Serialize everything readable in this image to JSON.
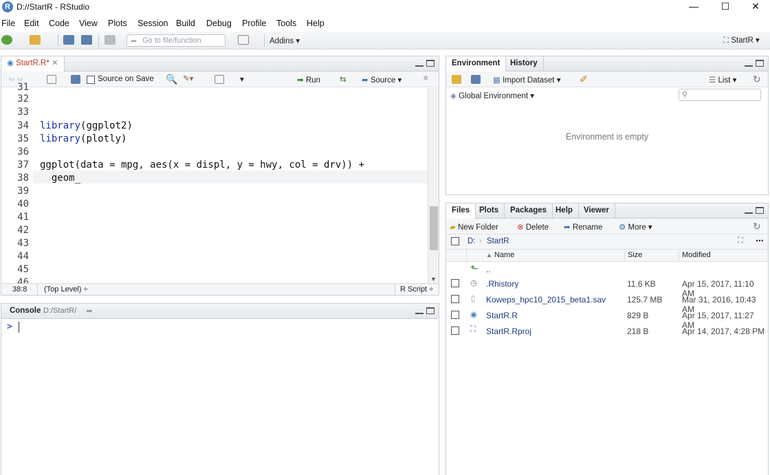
{
  "window": {
    "title": "D://StartR - RStudio",
    "logo_letter": "R",
    "minimize": "—",
    "maximize": "☐",
    "close": "✕"
  },
  "menu": [
    "File",
    "Edit",
    "Code",
    "View",
    "Plots",
    "Session",
    "Build",
    "Debug",
    "Profile",
    "Tools",
    "Help"
  ],
  "toolbar": {
    "goto_placeholder": "Go to file/function",
    "addins": "Addins",
    "project": "StartR"
  },
  "editor": {
    "tab_label": "StartR.R*",
    "source_on_save": "Source on Save",
    "run": "Run",
    "source": "Source",
    "line_numbers": [
      "31",
      "32",
      "33",
      "34",
      "35",
      "36",
      "37",
      "38",
      "39",
      "40",
      "41",
      "42",
      "43",
      "44",
      "45",
      "46"
    ],
    "code_lines": [
      {
        "line": "34",
        "fn": "library",
        "rest": "(ggplot2)"
      },
      {
        "line": "35",
        "fn": "library",
        "rest": "(plotly)"
      },
      {
        "line": "37",
        "fn": "",
        "rest": "ggplot(data = mpg, aes(x = displ, y = hwy, col = drv)) +"
      },
      {
        "line": "38",
        "fn": "",
        "rest": "  geom_"
      }
    ],
    "cursor_pos": "38:8",
    "scope": "(Top Level)",
    "file_type": "R Script"
  },
  "console": {
    "title": "Console",
    "path": "D:/StartR/",
    "prompt": ">"
  },
  "environment": {
    "tabs": [
      "Environment",
      "History"
    ],
    "import_dataset": "Import Dataset",
    "list_view": "List",
    "scope": "Global Environment",
    "empty_message": "Environment is empty"
  },
  "files": {
    "tabs": [
      "Files",
      "Plots",
      "Packages",
      "Help",
      "Viewer"
    ],
    "new_folder": "New Folder",
    "delete": "Delete",
    "rename": "Rename",
    "more": "More",
    "breadcrumb_root": "D:",
    "breadcrumb_folder": "StartR",
    "col_name": "Name",
    "col_size": "Size",
    "col_modified": "Modified",
    "parent": "..",
    "rows": [
      {
        "name": ".Rhistory",
        "size": "11.6 KB",
        "modified": "Apr 15, 2017, 11:10 AM"
      },
      {
        "name": "Koweps_hpc10_2015_beta1.sav",
        "size": "125.7 MB",
        "modified": "Mar 31, 2016, 10:43 AM"
      },
      {
        "name": "StartR.R",
        "size": "829 B",
        "modified": "Apr 15, 2017, 11:27 AM"
      },
      {
        "name": "StartR.Rproj",
        "size": "218 B",
        "modified": "Apr 14, 2017, 4:28 PM"
      }
    ]
  }
}
